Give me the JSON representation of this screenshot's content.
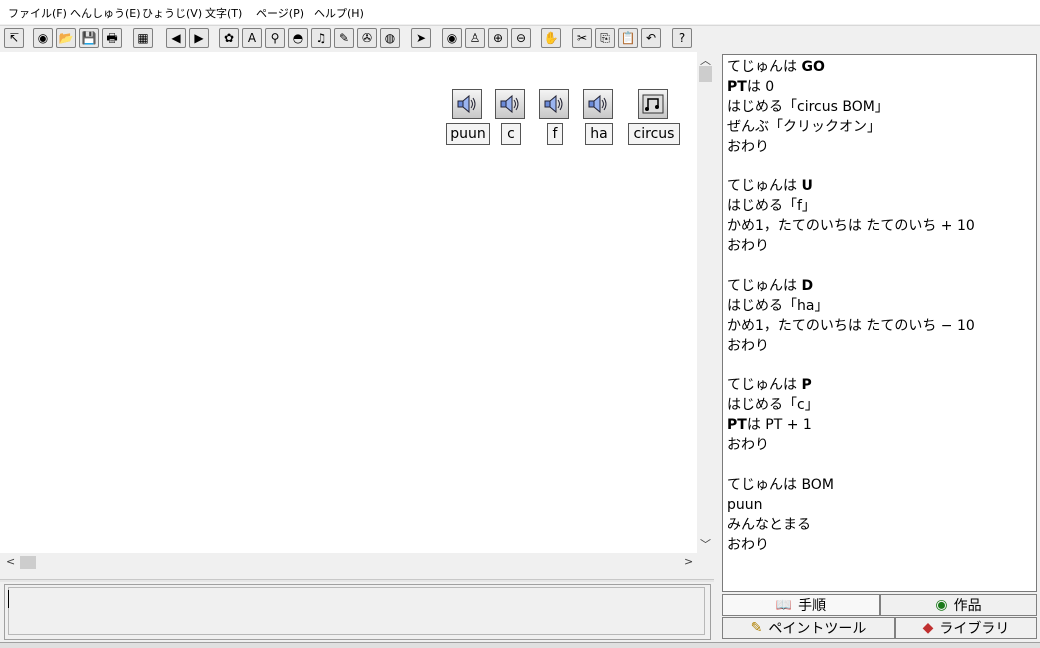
{
  "menu": [
    {
      "label": "ファイル(F)"
    },
    {
      "label": "へんしゅう(E)"
    },
    {
      "label": "ひょうじ(V)"
    },
    {
      "label": "文字(T)"
    },
    {
      "label": "ページ(P)"
    },
    {
      "label": "ヘルプ(H)"
    }
  ],
  "toolbar_glyphs": [
    "↸",
    "◉",
    "📂",
    "💾",
    "🖶",
    "▦",
    "◀",
    "▶",
    "✿",
    "A",
    "⚲",
    "◓",
    "♫",
    "✎",
    "✇",
    "◍",
    "➤",
    "◉",
    "♙",
    "⊕",
    "⊖",
    "✋",
    "✂",
    "⎘",
    "📋",
    "↶",
    "?"
  ],
  "sounds": [
    {
      "label": "puun"
    },
    {
      "label": "c"
    },
    {
      "label": "f"
    },
    {
      "label": "ha"
    },
    {
      "label": "circus"
    }
  ],
  "script_lines": [
    {
      "text": "てじゅんは ",
      "bold": "GO"
    },
    {
      "text": "",
      "bold": "PT",
      "rest": "は  0"
    },
    {
      "text": "はじめる「circus BOM」"
    },
    {
      "text": "ぜんぶ「クリックオン」"
    },
    {
      "text": "おわり"
    },
    {
      "text": ""
    },
    {
      "text": "てじゅんは ",
      "bold": "U"
    },
    {
      "text": "はじめる「f」"
    },
    {
      "text": "かめ1，たてのいちは  たてのいち + 10"
    },
    {
      "text": "おわり"
    },
    {
      "text": ""
    },
    {
      "text": "てじゅんは ",
      "bold": "D"
    },
    {
      "text": "はじめる「ha」"
    },
    {
      "text": "かめ1，たてのいちは  たてのいち − 10"
    },
    {
      "text": "おわり"
    },
    {
      "text": ""
    },
    {
      "text": "てじゅんは ",
      "bold": "P"
    },
    {
      "text": "はじめる「c」"
    },
    {
      "text": "",
      "bold": "PT",
      "rest": "は  PT  +  1"
    },
    {
      "text": "おわり"
    },
    {
      "text": ""
    },
    {
      "text": "てじゅんは BOM"
    },
    {
      "text": "puun"
    },
    {
      "text": "みんなとまる"
    },
    {
      "text": "おわり"
    }
  ],
  "tabs": {
    "procedure": "手順",
    "works": "作品",
    "paint": "ペイントツール",
    "library": "ライブラリ"
  },
  "scroll": {
    "left": "<",
    "right": ">",
    "up": "︿",
    "down": "﹀"
  }
}
